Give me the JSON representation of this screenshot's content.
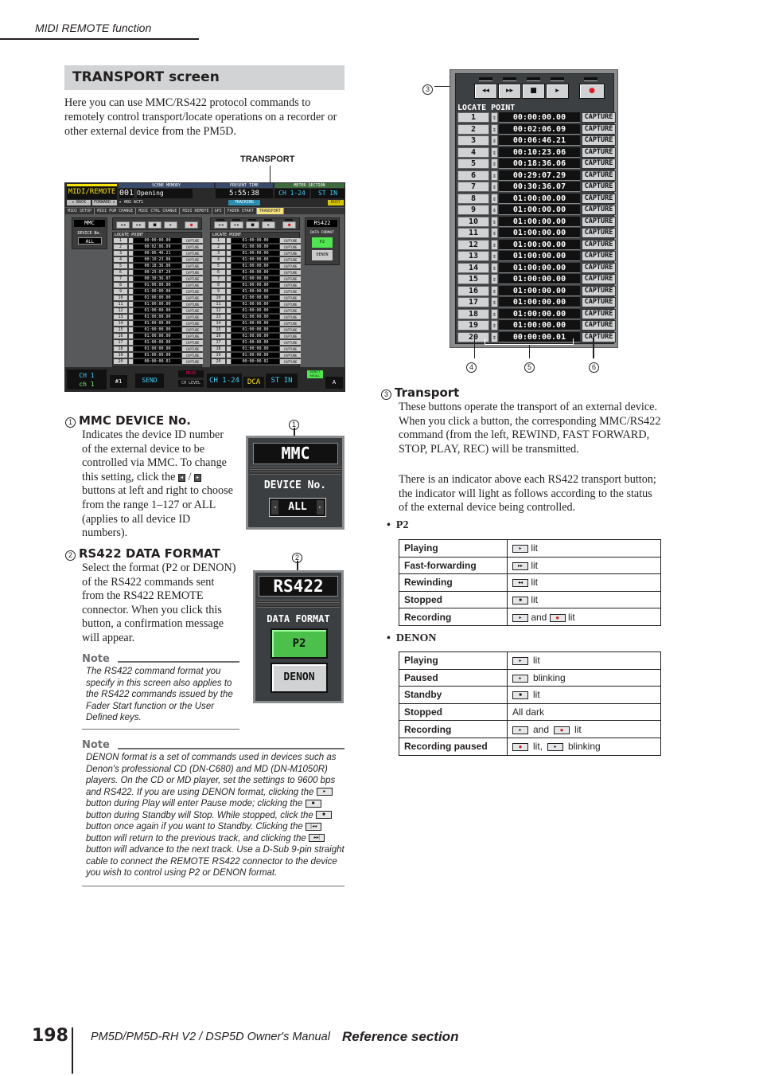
{
  "header": {
    "running_title": "MIDI REMOTE function"
  },
  "section": {
    "title": "TRANSPORT screen",
    "intro": "Here you can use MMC/RS422 protocol commands to remotely control transport/locate operations on a recorder or other external device from the PM5D.",
    "screenshot_callout": "TRANSPORT"
  },
  "screen": {
    "global_label": "GLOBAL",
    "global_value": "MIDI/REMOTE",
    "back": "◂ BACK",
    "forward": "FORWARD ▸",
    "scene_memory_label": "SCENE MEMORY",
    "scene_number": "001",
    "scene_name": "Opening",
    "next_scene": "▸ 002 ACT1",
    "present_time_label": "PRESENT TIME",
    "present_time": "5:55:38",
    "tracking": "TRACKING",
    "meter_label": "METER SECTION",
    "meter_ch": "CH 1-24",
    "meter_st": "ST IN",
    "busy": "BUSY",
    "tabs": [
      "MIDI SETUP",
      "MIDI PGM CHANGE",
      "MIDI CTRL CHANGE",
      "MIDI REMOTE",
      "GPI",
      "FADER START",
      "TRANSPORT"
    ],
    "mmc_title": "MMC",
    "device_label": "DEVICE No.",
    "device_value": "ALL",
    "rs422_title": "RS422",
    "data_format_label": "DATA FORMAT",
    "format_p2": "P2",
    "format_denon": "DENON",
    "locate_label": "LOCATE POINT",
    "capture": "CAPTURE",
    "mmc_locate": [
      "00:00:00.00",
      "00:02:06.09",
      "00:06:46.21",
      "00:10:23.06",
      "00:18:36.06",
      "00:29:07.29",
      "00:30:36.07",
      "01:00:00.00",
      "01:00:00.00",
      "01:00:00.00",
      "01:00:00.00",
      "01:00:00.00",
      "01:00:00.00",
      "01:00:00.00",
      "01:00:00.00",
      "01:00:00.00",
      "01:00:00.00",
      "01:00:00.00",
      "01:00:00.00",
      "00:00:00.01"
    ],
    "rs422_locate": [
      "01:00:00.00",
      "01:00:00.00",
      "01:00:00.00",
      "01:00:00.00",
      "01:00:00.00",
      "01:00:00.00",
      "01:00:00.00",
      "01:00:00.00",
      "01:00:00.00",
      "01:00:00.00",
      "01:00:00.00",
      "01:00:00.00",
      "01:00:00.00",
      "01:00:00.00",
      "01:00:00.00",
      "01:00:00.00",
      "01:00:00.00",
      "01:00:00.00",
      "01:00:00.00",
      "00:00:00.02"
    ],
    "bottom": {
      "selected_ch_label": "SELECTED CH",
      "selected_ch": "CH 1",
      "selected_name": "ch 1",
      "mix_section_label": "MIX SECTION",
      "mix_value": "SEND",
      "mix_bus": "MX20",
      "ch_level": "CH LEVEL",
      "input_ch": "CH 1-24",
      "fader_mode": "DCA",
      "st_in": "ST IN",
      "direct_recall": "DIRECT RECALL",
      "user_bank": "A",
      "workgroup": "#1"
    }
  },
  "transport_buttons": [
    {
      "name": "rewind",
      "glyph": "◂◂"
    },
    {
      "name": "fast-forward",
      "glyph": "▸▸"
    },
    {
      "name": "stop",
      "glyph": "■"
    },
    {
      "name": "play",
      "glyph": "▸"
    },
    {
      "name": "rec",
      "glyph": "●"
    }
  ],
  "items": [
    {
      "num": "1",
      "title": "MMC DEVICE No.",
      "body_a": "Indicates the device ID number of the external device to be controlled via MMC. To change this setting, click the",
      "body_b": "buttons at left and right to choose from the range 1–127 or ALL (applies to all device ID numbers)."
    },
    {
      "num": "2",
      "title": "RS422 DATA FORMAT",
      "body": "Select the format (P2 or DENON) of the RS422 commands sent from the RS422 REMOTE connector. When you click this button, a confirmation message will appear."
    },
    {
      "num": "3",
      "title": "Transport",
      "body": "These buttons operate the transport of an external device. When you click a button, the corresponding MMC/RS422 command (from the left, REWIND, FAST FORWARD, STOP, PLAY, REC) will be transmitted.",
      "body2": "There is an indicator above each RS422 transport button; the indicator will light as follows according to the status of the external device being controlled."
    }
  ],
  "callouts": [
    "1",
    "2",
    "3",
    "4",
    "5",
    "6"
  ],
  "notes": [
    {
      "label": "Note",
      "text": "The RS422 command format you specify in this screen also applies to the RS422 commands issued by the Fader Start function or the User Defined keys."
    },
    {
      "label": "Note",
      "parts": [
        "DENON format is a set of commands used in devices such as Denon's professional CD (DN-C680) and MD (DN-M1050R) players. On the CD or MD player, set the settings to 9600 bps and RS422. If you are using DENON format, clicking the",
        "button during Play will enter Pause mode; clicking the",
        "button during Standby will Stop. While stopped, click the",
        "button once again if you want to Standby. Clicking the",
        "button will return to the previous track, and clicking the",
        "button will advance to the next track. Use a D-Sub 9-pin straight cable to connect the REMOTE RS422 connector to the device you wish to control using P2 or DENON format."
      ]
    }
  ],
  "p2_table": {
    "label": "P2",
    "rows": [
      {
        "state": "Playing",
        "icons": [
          "▸"
        ],
        "text": "lit"
      },
      {
        "state": "Fast-forwarding",
        "icons": [
          "▸▸"
        ],
        "text": "lit"
      },
      {
        "state": "Rewinding",
        "icons": [
          "◂◂"
        ],
        "text": "lit"
      },
      {
        "state": "Stopped",
        "icons": [
          "■"
        ],
        "text": "lit"
      },
      {
        "state": "Recording",
        "icons": [
          "▸",
          "●"
        ],
        "text": "and|lit"
      }
    ]
  },
  "denon_table": {
    "label": "DENON",
    "rows": [
      {
        "state": "Playing",
        "desc": "lit"
      },
      {
        "state": "Paused",
        "desc": "blinking"
      },
      {
        "state": "Standby",
        "desc": "lit"
      },
      {
        "state": "Stopped",
        "desc": "All dark"
      },
      {
        "state": "Recording",
        "desc_a": "and",
        "desc_b": "lit"
      },
      {
        "state": "Recording paused",
        "desc_a": "lit,",
        "desc_b": "blinking"
      }
    ]
  },
  "footer": {
    "page": "198",
    "manual": "PM5D/PM5D-RH V2 / DSP5D Owner's Manual",
    "section": "Reference section"
  }
}
